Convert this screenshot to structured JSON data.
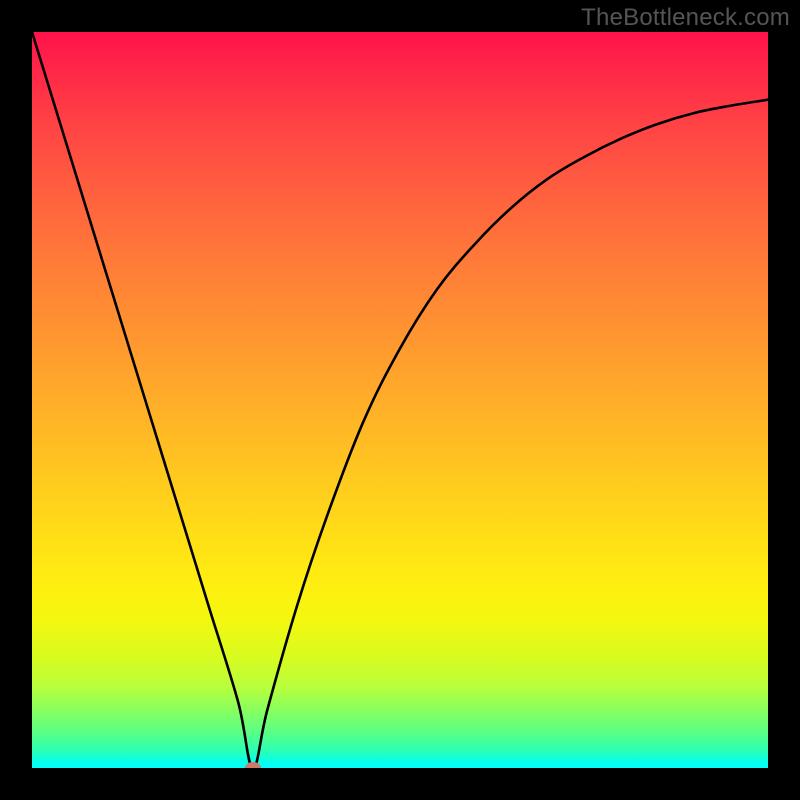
{
  "watermark": "TheBottleneck.com",
  "chart_data": {
    "type": "line",
    "title": "",
    "xlabel": "",
    "ylabel": "",
    "xlim": [
      0,
      100
    ],
    "ylim": [
      0,
      100
    ],
    "grid": false,
    "legend": false,
    "background_gradient": {
      "top_color": "#ff124b",
      "bottom_color": "#00ffff",
      "stops": [
        "red",
        "orange",
        "yellow",
        "green",
        "cyan"
      ]
    },
    "series": [
      {
        "name": "bottleneck-curve",
        "color": "#000000",
        "x": [
          0,
          4,
          8,
          12,
          16,
          20,
          24,
          28,
          30,
          32,
          36,
          40,
          45,
          50,
          55,
          60,
          65,
          70,
          75,
          80,
          85,
          90,
          95,
          100
        ],
        "y": [
          100,
          87,
          74,
          61,
          48,
          35,
          22,
          9,
          0,
          8,
          22,
          34,
          47,
          57,
          65,
          71,
          76,
          80,
          83,
          85.5,
          87.5,
          89,
          90,
          90.8
        ]
      }
    ],
    "marker": {
      "name": "current-point",
      "x": 30,
      "y": 0,
      "color": "#cc7a6a"
    }
  }
}
